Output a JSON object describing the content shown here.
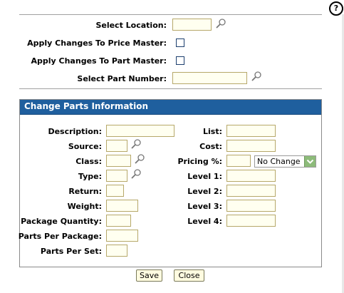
{
  "help": {
    "glyph": "?"
  },
  "top_form": {
    "select_location": {
      "label": "Select Location:",
      "value": ""
    },
    "apply_price_master": {
      "label": "Apply Changes To Price Master:",
      "checked": false
    },
    "apply_part_master": {
      "label": "Apply Changes To Part Master:",
      "checked": false
    },
    "select_part_number": {
      "label": "Select Part Number:",
      "value": ""
    }
  },
  "panel": {
    "title": "Change Parts Information",
    "left_fields": [
      {
        "label": "Description:",
        "value": ""
      },
      {
        "label": "Source:",
        "value": ""
      },
      {
        "label": "Class:",
        "value": ""
      },
      {
        "label": "Type:",
        "value": ""
      },
      {
        "label": "Return:",
        "value": ""
      },
      {
        "label": "Weight:",
        "value": ""
      },
      {
        "label": "Package Quantity:",
        "value": ""
      },
      {
        "label": "Parts Per Package:",
        "value": ""
      },
      {
        "label": "Parts Per Set:",
        "value": ""
      }
    ],
    "right_fields": [
      {
        "label": "List:",
        "value": ""
      },
      {
        "label": "Cost:",
        "value": ""
      },
      {
        "label": "Pricing %:",
        "value": ""
      },
      {
        "label": "Level 1:",
        "value": ""
      },
      {
        "label": "Level 2:",
        "value": ""
      },
      {
        "label": "Level 3:",
        "value": ""
      },
      {
        "label": "Level 4:",
        "value": ""
      }
    ],
    "pricing_select": {
      "selected": "No Change"
    }
  },
  "buttons": {
    "save": "Save",
    "close": "Close"
  },
  "colors": {
    "panel_header": "#1f5f9e",
    "input_background": "#fffff0",
    "input_border": "#b6a86a",
    "dropdown_arrow": "#8dbb7a"
  },
  "icons": {
    "lookup": "magnifier-icon",
    "help": "help-icon",
    "dropdown": "chevron-down-icon"
  }
}
